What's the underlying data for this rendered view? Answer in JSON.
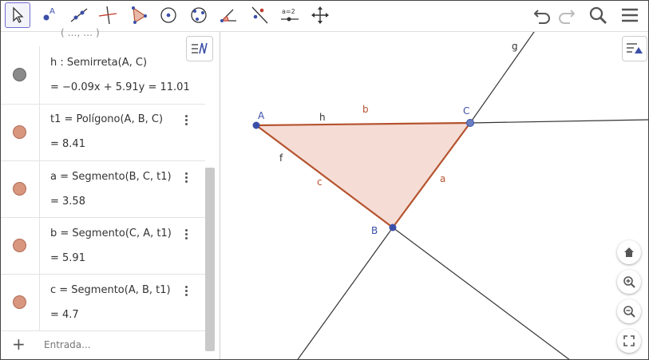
{
  "toolbar": {
    "tools": [
      "move-tool",
      "point-tool",
      "line-tool",
      "perpendicular-tool",
      "polygon-tool",
      "circle-center-tool",
      "circle-three-points-tool",
      "angle-tool",
      "reflect-tool",
      "slider-tool",
      "move-graphics-tool"
    ],
    "slider_label": "a=2",
    "right": [
      "undo-icon",
      "redo-icon",
      "search-icon",
      "menu-icon"
    ]
  },
  "algebra": {
    "rows": [
      {
        "definition": "h : Semirreta(A, C)",
        "value": "= −0.09x + 5.91y = 11.01",
        "color": "#8a8a8a"
      },
      {
        "definition": "t1 = Polígono(A, B, C)",
        "value": "= 8.41",
        "color": "#d8967f"
      },
      {
        "definition": "a = Segmento(B, C, t1)",
        "value": "= 3.58",
        "color": "#d8967f"
      },
      {
        "definition": "b = Segmento(C, A, t1)",
        "value": "= 5.91",
        "color": "#d8967f"
      },
      {
        "definition": "c = Segmento(A, B, t1)",
        "value": "= 4.7",
        "color": "#d8967f"
      }
    ],
    "input_placeholder": "Entrada..."
  },
  "graphics": {
    "labels": {
      "A": "A",
      "B": "B",
      "C": "C",
      "a": "a",
      "b": "b",
      "c": "c",
      "f": "f",
      "g": "g",
      "h": "h"
    },
    "polygon_fill": "#f5ddd6",
    "polygon_stroke": "#b5532f",
    "point_color": "#3b4fa8"
  }
}
